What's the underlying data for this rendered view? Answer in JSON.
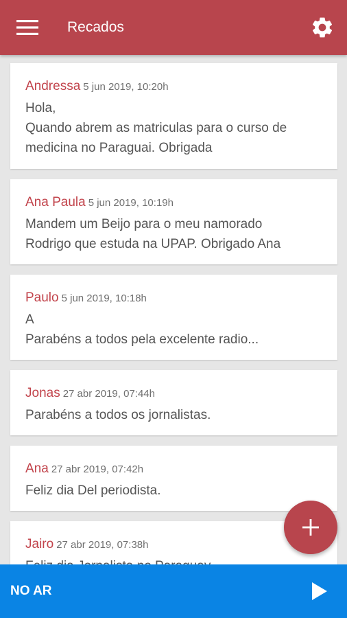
{
  "appbar": {
    "title": "Recados",
    "menu_icon": "hamburger-menu-icon",
    "settings_icon": "gear-icon",
    "color": "#b8454d"
  },
  "messages": [
    {
      "author": "Andressa",
      "date": "5 jun 2019, 10:20h",
      "text": "Hola,\nQuando abrem as matriculas para o curso de\nmedicina no Paraguai. Obrigada"
    },
    {
      "author": "Ana Paula",
      "date": "5 jun 2019, 10:19h",
      "text": "Mandem um Beijo para o meu namorado\nRodrigo que estuda na UPAP. Obrigado Ana"
    },
    {
      "author": "Paulo",
      "date": "5 jun 2019, 10:18h",
      "text": "A\nParabéns a todos pela excelente radio..."
    },
    {
      "author": "Jonas",
      "date": "27 abr 2019, 07:44h",
      "text": "Parabéns a todos os jornalistas."
    },
    {
      "author": "Ana",
      "date": "27 abr 2019, 07:42h",
      "text": "Feliz dia Del periodista."
    },
    {
      "author": "Jairo",
      "date": "27 abr 2019, 07:38h",
      "text": "Feliz dia Jornalista no Paraguay"
    }
  ],
  "fab": {
    "icon": "plus-icon"
  },
  "player": {
    "label": "NO AR",
    "play_icon": "play-icon",
    "color": "#0a84e4"
  }
}
